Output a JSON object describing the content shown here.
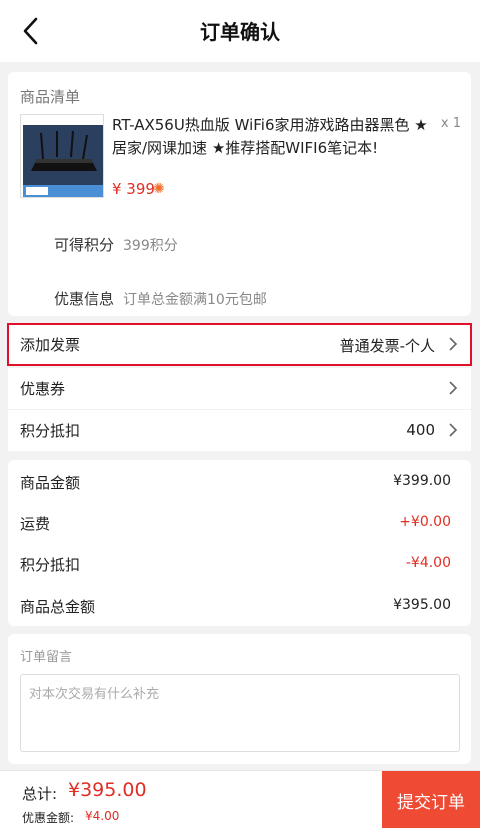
{
  "header": {
    "title": "订单确认",
    "back_icon": "chevron-left-icon"
  },
  "goods": {
    "section_title": "商品清单",
    "product": {
      "name": "RT-AX56U热血版 WiFi6家用游戏路由器黑色 ★居家/网课加速 ★推荐搭配WIFI6笔记本!",
      "quantity": "x 1",
      "price": "¥ 399",
      "price_icon": "sparkle-icon"
    },
    "points_label": "可得积分",
    "points_value": "399积分",
    "promo_label": "优惠信息",
    "promo_value": "订单总金额满10元包邮"
  },
  "options": [
    {
      "label": "添加发票",
      "value": "普通发票-个人"
    },
    {
      "label": "优惠券",
      "value": ""
    },
    {
      "label": "积分抵扣",
      "value": "400"
    }
  ],
  "summary": [
    {
      "label": "商品金额",
      "value": "¥399.00"
    },
    {
      "label": "运费",
      "value": "+¥0.00"
    },
    {
      "label": "积分抵扣",
      "value": "-¥4.00"
    },
    {
      "label": "商品总金额",
      "value": "¥395.00"
    }
  ],
  "memo": {
    "label": "订单留言",
    "placeholder": "对本次交易有什么补充"
  },
  "footer": {
    "total_label": "总计:",
    "total_value": "¥395.00",
    "discount_label": "优惠金额:",
    "discount_value": "¥4.00",
    "submit_label": "提交订单"
  },
  "colors": {
    "accent": "#e02e24",
    "submit_bg": "#ee4a34",
    "highlight": "#e0102a"
  }
}
